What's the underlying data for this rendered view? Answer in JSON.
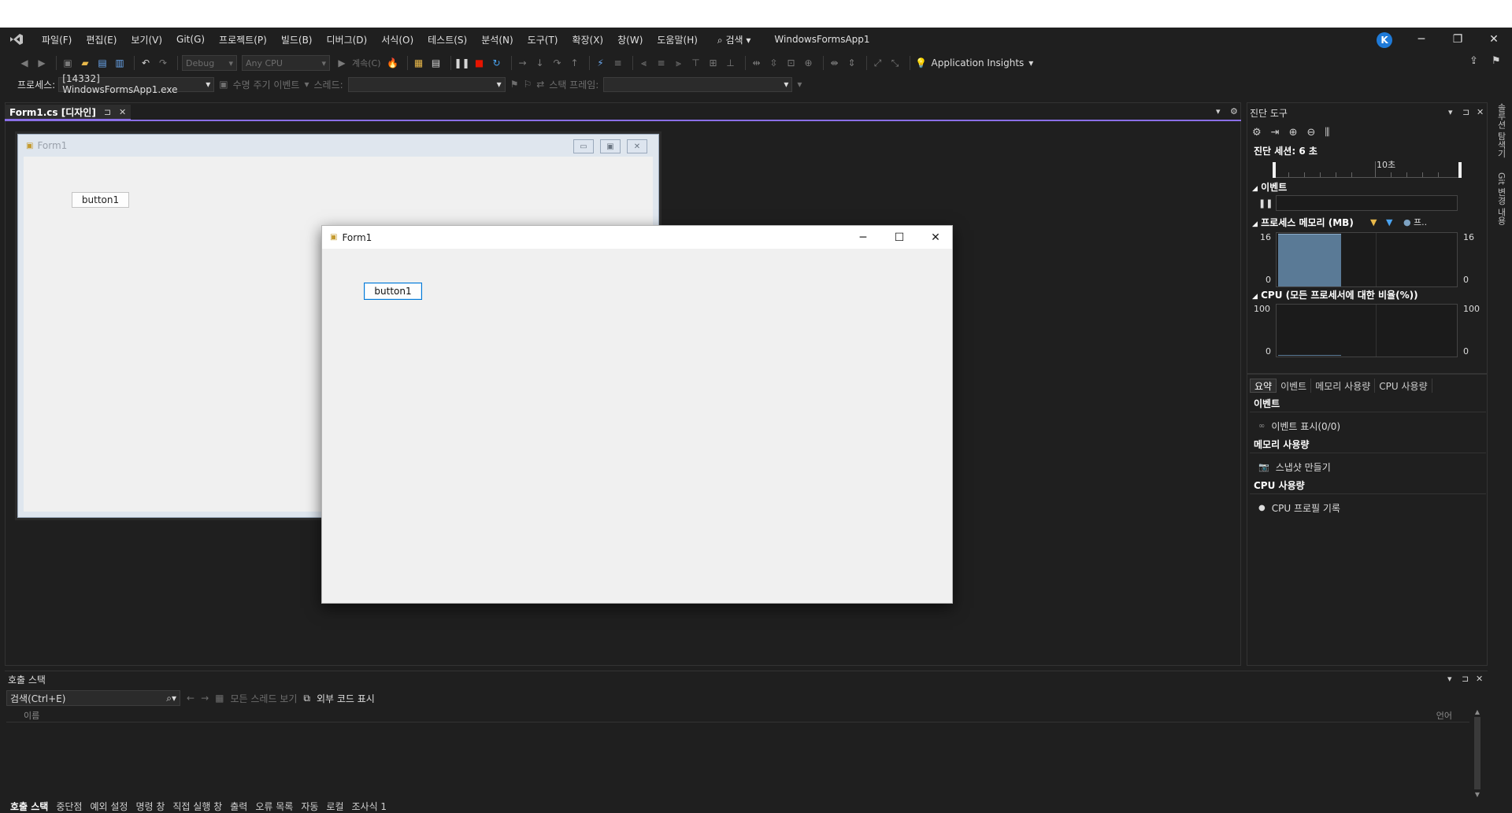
{
  "menu": {
    "items": [
      "파일(F)",
      "편집(E)",
      "보기(V)",
      "Git(G)",
      "프로젝트(P)",
      "빌드(B)",
      "디버그(D)",
      "서식(O)",
      "테스트(S)",
      "분석(N)",
      "도구(T)",
      "확장(X)",
      "창(W)",
      "도움말(H)"
    ],
    "search_label": "검색",
    "app_title": "WindowsFormsApp1",
    "avatar_letter": "K"
  },
  "toolbar1": {
    "config": "Debug",
    "platform": "Any CPU",
    "continue_label": "계속(C)",
    "insights_label": "Application Insights"
  },
  "toolbar2": {
    "process_label": "프로세스:",
    "process_value": "[14332] WindowsFormsApp1.exe",
    "lifecycle_label": "수명 주기 이벤트",
    "thread_label": "스레드:",
    "thread_value": "",
    "stackframe_label": "스택 프레임:",
    "stackframe_value": ""
  },
  "doc_tab": {
    "label": "Form1.cs [디자인]",
    "pin": "⊐",
    "close": "✕"
  },
  "design_form": {
    "title": "Form1",
    "button_label": "button1"
  },
  "run_form": {
    "title": "Form1",
    "button_label": "button1"
  },
  "diag": {
    "title": "진단 도구",
    "session": "진단 세션: 6 초",
    "timeline_label": "10초",
    "events_header": "이벤트",
    "memory_header": "프로세스 메모리 (MB)",
    "memory_legend_extra": "프..",
    "memory_max": "16",
    "memory_min": "0",
    "cpu_header": "CPU (모든 프로세서에 대한 비율(%))",
    "cpu_max": "100",
    "cpu_min": "0",
    "memory_level_pct": 100,
    "tabs": [
      "요약",
      "이벤트",
      "메모리 사용량",
      "CPU 사용량"
    ],
    "summary": {
      "events_title": "이벤트",
      "events_item": "이벤트 표시(0/0)",
      "memory_title": "메모리 사용량",
      "memory_item": "스냅샷 만들기",
      "cpu_title": "CPU 사용량",
      "cpu_item": "CPU 프로필 기록"
    }
  },
  "right_strip": {
    "items": [
      "솔루션 탐색기",
      "Git 변경 내용"
    ]
  },
  "callstack": {
    "title": "호출 스택",
    "search_placeholder": "검색(Ctrl+E)",
    "show_all_threads": "모든 스레드 보기",
    "show_external": "외부 코드 표시",
    "col_name": "이름",
    "col_lang": "언어"
  },
  "bottom_tabs": [
    "호출 스택",
    "중단점",
    "예외 설정",
    "명령 창",
    "직접 실행 창",
    "출력",
    "오류 목록",
    "자동",
    "로컬",
    "조사식 1"
  ],
  "colors": {
    "accent": "#8a6fe6",
    "memory_bar": "#5a7a96",
    "avatar": "#1e7ad8",
    "stop": "#e51400"
  }
}
